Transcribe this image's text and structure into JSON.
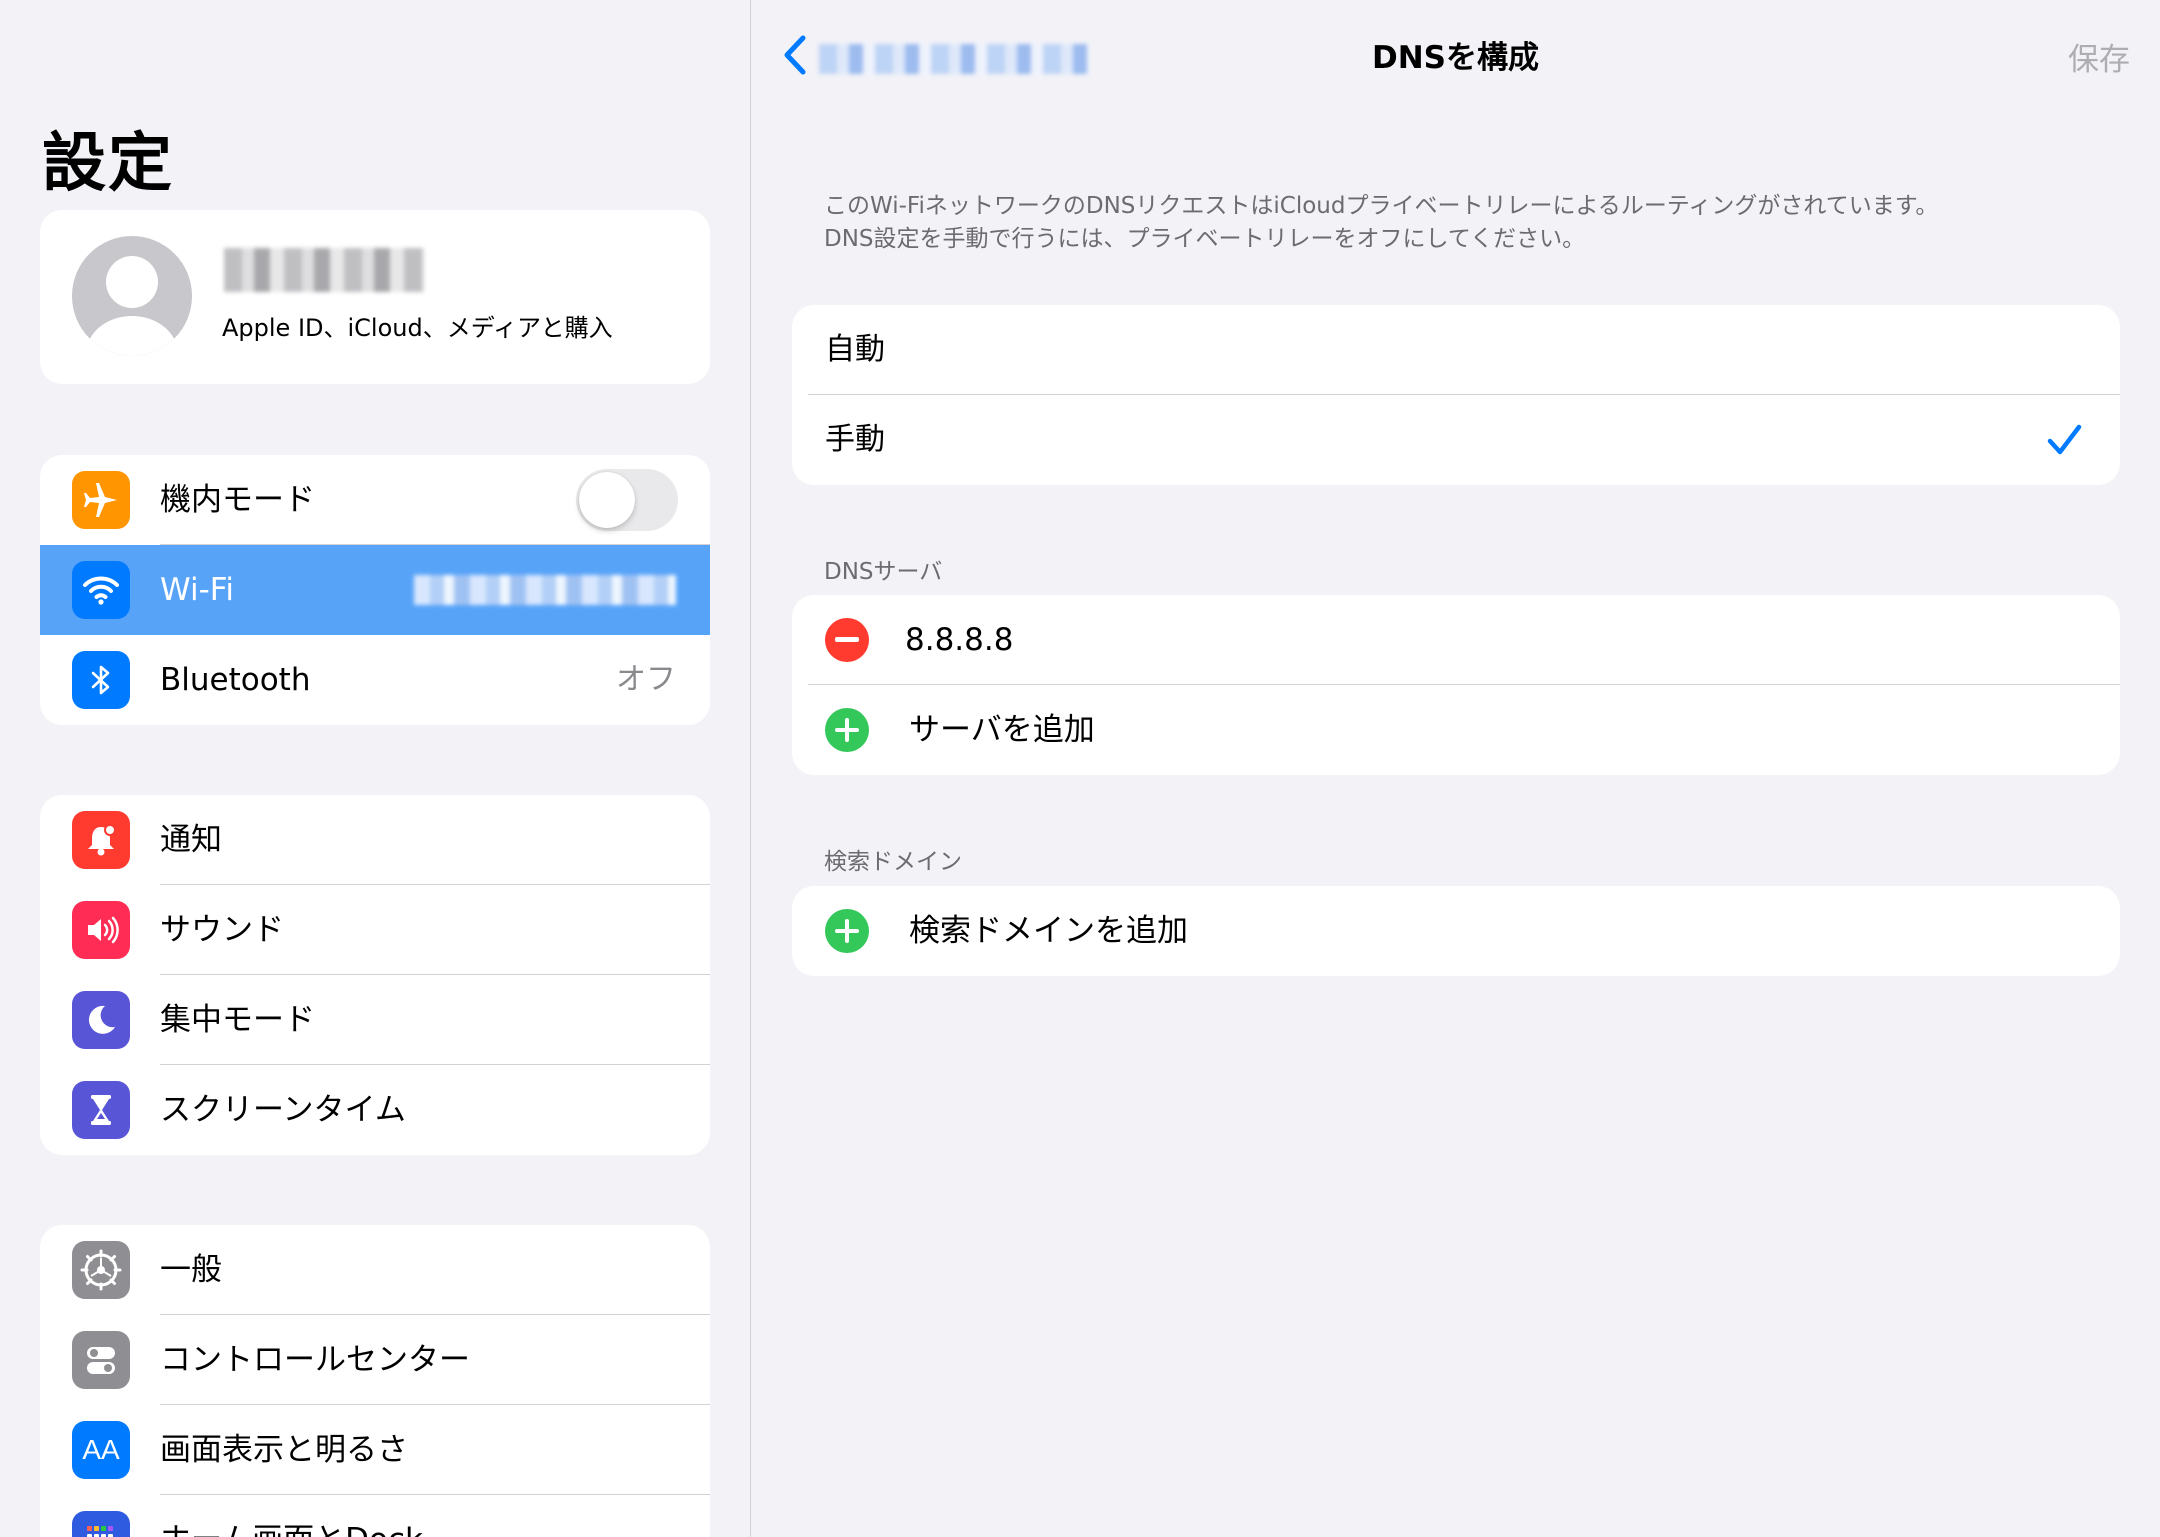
{
  "sidebar": {
    "title": "設定",
    "profile": {
      "subtitle": "Apple ID、iCloud、メディアと購入"
    },
    "group1": [
      {
        "label": "機内モード",
        "icon": "airplane-icon",
        "color": "#ff9500"
      },
      {
        "label": "Wi-Fi",
        "icon": "wifi-icon",
        "color": "#007aff"
      },
      {
        "label": "Bluetooth",
        "value": "オフ",
        "icon": "bluetooth-icon",
        "color": "#007aff"
      }
    ],
    "group2": [
      {
        "label": "通知",
        "icon": "bell-icon",
        "color": "#ff3b30"
      },
      {
        "label": "サウンド",
        "icon": "speaker-icon",
        "color": "#ff2d55"
      },
      {
        "label": "集中モード",
        "icon": "moon-icon",
        "color": "#5856d6"
      },
      {
        "label": "スクリーンタイム",
        "icon": "hourglass-icon",
        "color": "#5856d6"
      }
    ],
    "group3": [
      {
        "label": "一般",
        "icon": "gear-icon",
        "color": "#8e8e93"
      },
      {
        "label": "コントロールセンター",
        "icon": "switches-icon",
        "color": "#8e8e93"
      },
      {
        "label": "画面表示と明るさ",
        "icon": "text-size-icon",
        "icon_text": "AA",
        "color": "#007aff"
      },
      {
        "label": "ホーム画面とDock",
        "icon": "home-grid-icon",
        "color": "#2f5be0"
      }
    ]
  },
  "detail": {
    "nav": {
      "title": "DNSを構成",
      "save_label": "保存"
    },
    "note_line1": "このWi-FiネットワークのDNSリクエストはiCloudプライベートリレーによるルーティングがされています。",
    "note_line2": "DNS設定を手動で行うには、プライベートリレーをオフにしてください。",
    "mode": {
      "options": [
        "自動",
        "手動"
      ],
      "selected": "手動"
    },
    "dns_servers": {
      "header": "DNSサーバ",
      "servers": [
        "8.8.8.8"
      ],
      "add_label": "サーバを追加"
    },
    "search_domains": {
      "header": "検索ドメイン",
      "add_label": "検索ドメインを追加"
    }
  },
  "colors": {
    "accent": "#007aff",
    "selected_row": "#57a3f8",
    "remove": "#ff3b30",
    "add": "#34c759"
  }
}
